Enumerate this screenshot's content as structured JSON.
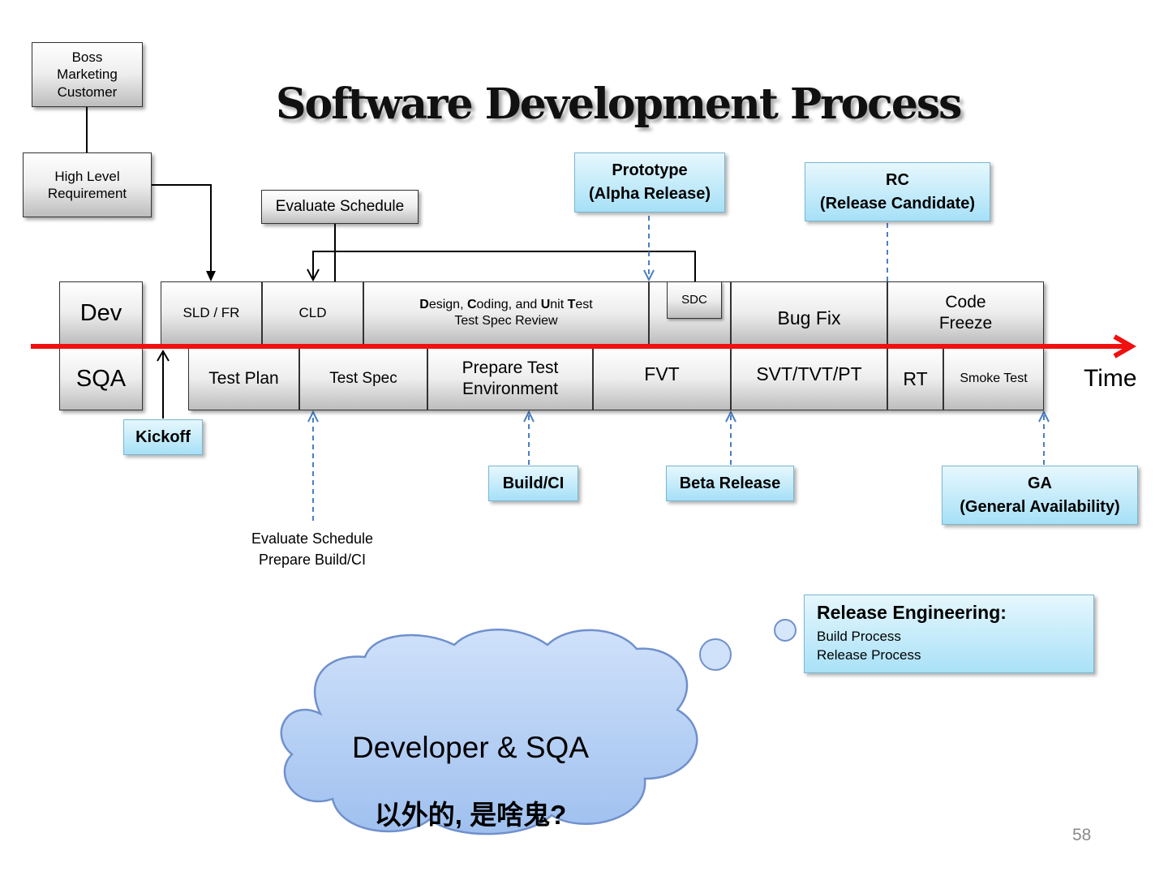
{
  "title": "Software Development Process",
  "stakeholders": {
    "sources": "Boss\nMarketing\nCustomer",
    "requirement": "High Level\nRequirement"
  },
  "evaluate_schedule_top": "Evaluate Schedule",
  "lanes": {
    "dev": "Dev",
    "sqa": "SQA"
  },
  "dev_phases": {
    "sld_fr": "SLD  / FR",
    "cld": "CLD",
    "design_line1_parts": [
      "D",
      "esign, ",
      "C",
      "oding, and ",
      "U",
      "nit ",
      "T",
      "est"
    ],
    "design_line2": "Test Spec Review",
    "sdc": "SDC",
    "bug_fix": "Bug Fix",
    "code_freeze": "Code\nFreeze"
  },
  "sqa_phases": {
    "test_plan": "Test Plan",
    "test_spec": "Test Spec",
    "prepare_env": "Prepare Test\nEnvironment",
    "fvt": "FVT",
    "svt": "SVT/TVT/PT",
    "rt": "RT",
    "smoke": "Smoke Test"
  },
  "time_label": "Time",
  "milestones": {
    "prototype": "Prototype\n(Alpha Release)",
    "rc": "RC\n(Release Candidate)",
    "kickoff": "Kickoff",
    "build_ci": "Build/CI",
    "beta": "Beta Release",
    "ga": "GA\n(General Availability)"
  },
  "evaluate_note": "Evaluate Schedule\nPrepare Build/CI",
  "release_engineering": {
    "heading": "Release Engineering:",
    "items": [
      "Build Process",
      "Release Process"
    ]
  },
  "cloud": {
    "line1": "Developer & SQA",
    "line2": "以外的, 是啥鬼?"
  },
  "page_number": "58",
  "colors": {
    "timeline": "#f01010",
    "milestone_fill": "#bfe9fa",
    "milestone_border": "#79b7d2",
    "dash_arrow": "#4a7fc1",
    "cloud_fill": "#a9c8f2",
    "cloud_border": "#7090cc"
  }
}
